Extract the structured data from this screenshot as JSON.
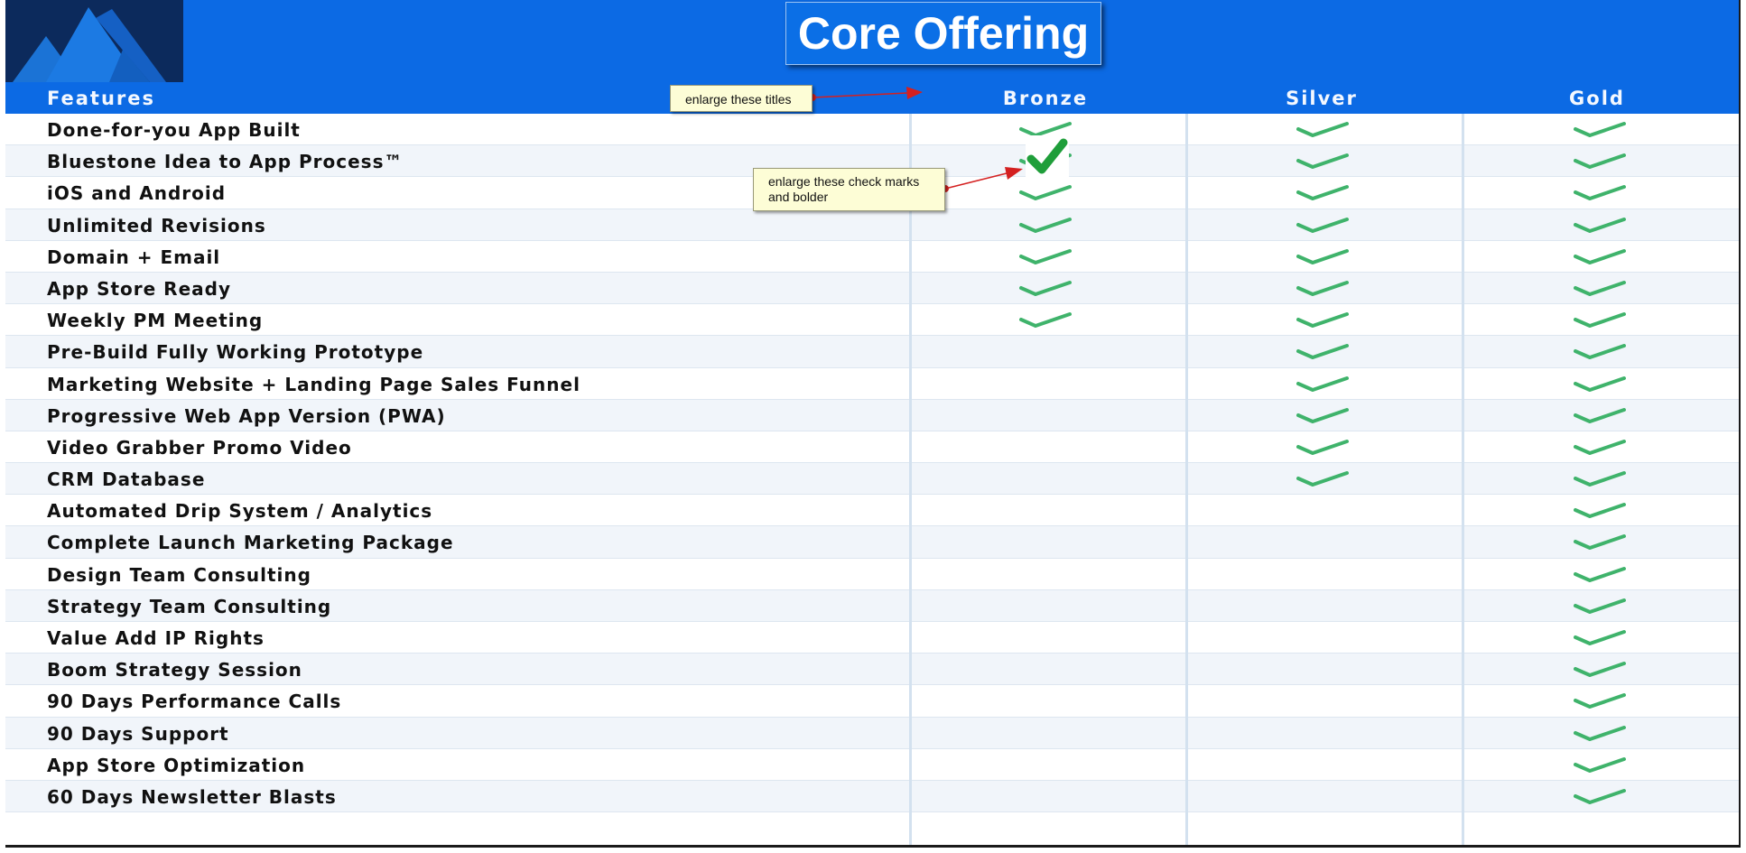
{
  "title": "Core Offering",
  "columns": {
    "features": "Features",
    "tiers": [
      "Bronze",
      "Silver",
      "Gold"
    ]
  },
  "features": [
    {
      "label": "Done-for-you App Built",
      "bronze": true,
      "silver": true,
      "gold": true
    },
    {
      "label": "Bluestone Idea to App Process™",
      "bronze": true,
      "silver": true,
      "gold": true
    },
    {
      "label": "iOS and Android",
      "bronze": true,
      "silver": true,
      "gold": true
    },
    {
      "label": "Unlimited Revisions",
      "bronze": true,
      "silver": true,
      "gold": true
    },
    {
      "label": "Domain + Email",
      "bronze": true,
      "silver": true,
      "gold": true
    },
    {
      "label": "App Store Ready",
      "bronze": true,
      "silver": true,
      "gold": true
    },
    {
      "label": "Weekly PM Meeting",
      "bronze": true,
      "silver": true,
      "gold": true
    },
    {
      "label": "Pre-Build Fully Working Prototype",
      "bronze": false,
      "silver": true,
      "gold": true
    },
    {
      "label": "Marketing Website + Landing Page Sales Funnel",
      "bronze": false,
      "silver": true,
      "gold": true
    },
    {
      "label": "Progressive Web App Version (PWA)",
      "bronze": false,
      "silver": true,
      "gold": true
    },
    {
      "label": "Video Grabber Promo Video",
      "bronze": false,
      "silver": true,
      "gold": true
    },
    {
      "label": "CRM Database",
      "bronze": false,
      "silver": true,
      "gold": true
    },
    {
      "label": "Automated Drip System / Analytics",
      "bronze": false,
      "silver": false,
      "gold": true
    },
    {
      "label": "Complete Launch Marketing Package",
      "bronze": false,
      "silver": false,
      "gold": true
    },
    {
      "label": "Design Team Consulting",
      "bronze": false,
      "silver": false,
      "gold": true
    },
    {
      "label": "Strategy Team Consulting",
      "bronze": false,
      "silver": false,
      "gold": true
    },
    {
      "label": "Value Add IP Rights",
      "bronze": false,
      "silver": false,
      "gold": true
    },
    {
      "label": "Boom Strategy Session",
      "bronze": false,
      "silver": false,
      "gold": true
    },
    {
      "label": "90 Days Performance Calls",
      "bronze": false,
      "silver": false,
      "gold": true
    },
    {
      "label": "90 Days Support",
      "bronze": false,
      "silver": false,
      "gold": true
    },
    {
      "label": "App Store Optimization",
      "bronze": false,
      "silver": false,
      "gold": true
    },
    {
      "label": "60 Days Newsletter Blasts",
      "bronze": false,
      "silver": false,
      "gold": true
    }
  ],
  "annotations": {
    "titles_note": "enlarge these titles",
    "checks_note_line1": "enlarge these check marks",
    "checks_note_line2": "and bolder"
  },
  "colors": {
    "header_blue": "#0c6ae4",
    "logo_navy": "#0c2a5c",
    "check_green": "#3fb36b",
    "callout_arrow": "#d42020"
  },
  "icons": {
    "check": "check-icon",
    "big_check": "bold-check-icon",
    "logo": "mountain-logo-icon"
  }
}
